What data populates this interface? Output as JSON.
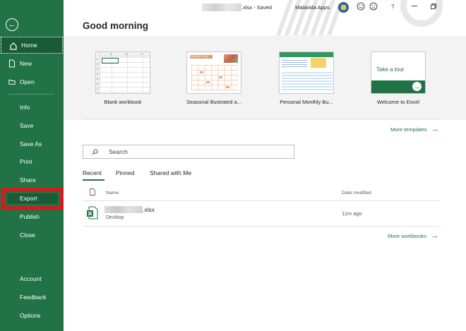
{
  "titlebar": {
    "doc_title": ".xlsx  -  Saved",
    "user_name": "Malavida Apps",
    "icons": [
      "smiley-icon",
      "frown-icon",
      "help-icon",
      "minimize-icon",
      "restore-icon"
    ],
    "help_glyph": "?"
  },
  "sidebar": {
    "back_glyph": "←",
    "items_top": [
      {
        "label": "Home",
        "icon": "home-icon",
        "active": true
      },
      {
        "label": "New",
        "icon": "new-document-icon"
      },
      {
        "label": "Open",
        "icon": "folder-icon"
      }
    ],
    "items_mid": [
      "Info",
      "Save",
      "Save As",
      "Print",
      "Share",
      "Export",
      "Publish",
      "Close"
    ],
    "items_bottom": [
      "Account",
      "Feedback",
      "Options"
    ]
  },
  "main": {
    "greeting": "Good morning",
    "templates": [
      {
        "label": "Blank workbook",
        "kind": "blank"
      },
      {
        "label": "Seasonal illustrated a...",
        "kind": "calendar",
        "mini_title": "September 20yy"
      },
      {
        "label": "Personal Monthly Bu...",
        "kind": "budget"
      },
      {
        "label": "Welcome to Excel",
        "kind": "tour",
        "tour_text": "Take a tour",
        "tour_arrow": "→"
      }
    ],
    "blank_columns": [
      "A",
      "B",
      "C"
    ],
    "blank_rows": [
      "1",
      "2",
      "3",
      "4",
      "5",
      "6",
      "7",
      "8"
    ],
    "more_templates": "More templates",
    "search_placeholder": "Search",
    "tabs": [
      {
        "label": "Recent",
        "active": true
      },
      {
        "label": "Pinned"
      },
      {
        "label": "Shared with Me"
      }
    ],
    "columns": {
      "name": "Name",
      "date": "Date modified"
    },
    "files": [
      {
        "name": ".xlsx",
        "location": "Desktop",
        "date": "11m ago",
        "icon": "excel-file-icon"
      }
    ],
    "more_workbooks": "More workbooks",
    "arrow_glyph": "→"
  },
  "colors": {
    "accent": "#217346",
    "accent_dark": "#185c37",
    "highlight_red": "#e3131b",
    "gallery_bg": "#f3f3f3"
  }
}
